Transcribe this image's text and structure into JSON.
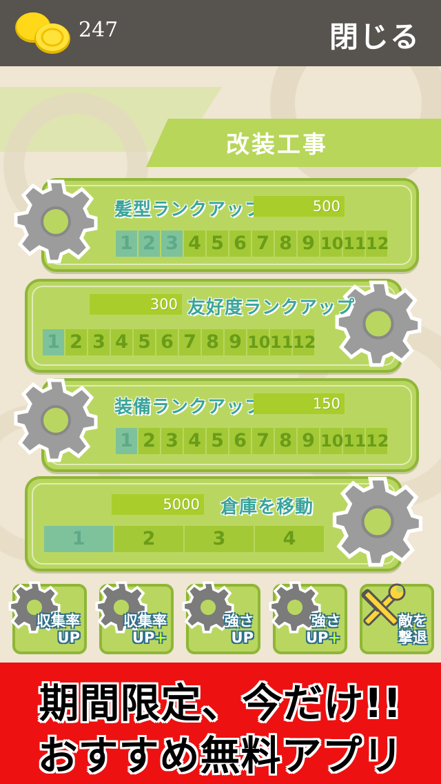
{
  "header": {
    "coin_count": "247",
    "close_label": "閉じる"
  },
  "title": "改装工事",
  "upgrades": [
    {
      "label": "髪型ランクアップ",
      "price": "500",
      "ranks": [
        "1",
        "2",
        "3",
        "4",
        "5",
        "6",
        "7",
        "8",
        "9",
        "10",
        "11",
        "12"
      ],
      "completed": 3
    },
    {
      "label": "友好度ランクアップ",
      "price": "300",
      "ranks": [
        "1",
        "2",
        "3",
        "4",
        "5",
        "6",
        "7",
        "8",
        "9",
        "10",
        "11",
        "12"
      ],
      "completed": 1
    },
    {
      "label": "装備ランクアップ",
      "price": "150",
      "ranks": [
        "1",
        "2",
        "3",
        "4",
        "5",
        "6",
        "7",
        "8",
        "9",
        "10",
        "11",
        "12"
      ],
      "completed": 1
    },
    {
      "label": "倉庫を移動",
      "price": "5000",
      "ranks": [
        "1",
        "2",
        "3",
        "4"
      ],
      "completed": 1
    }
  ],
  "shortcuts": [
    {
      "line1": "収集率",
      "line2": "UP",
      "plus": ""
    },
    {
      "line1": "収集率",
      "line2": "UP",
      "plus": "+"
    },
    {
      "line1": "強さ",
      "line2": "UP",
      "plus": ""
    },
    {
      "line1": "強さ",
      "line2": "UP",
      "plus": "+"
    },
    {
      "line1": "敵を",
      "line2": "撃退",
      "plus": ""
    }
  ],
  "ad": {
    "line1": "期間限定、今だけ!!",
    "line2": "おすすめ無料アプリ"
  },
  "colors": {
    "topbar": "#57534e",
    "panel": "#b9d760",
    "accent": "#a9cd2b",
    "completed_rank": "#7ec29c",
    "ad_background": "#ee1111"
  }
}
